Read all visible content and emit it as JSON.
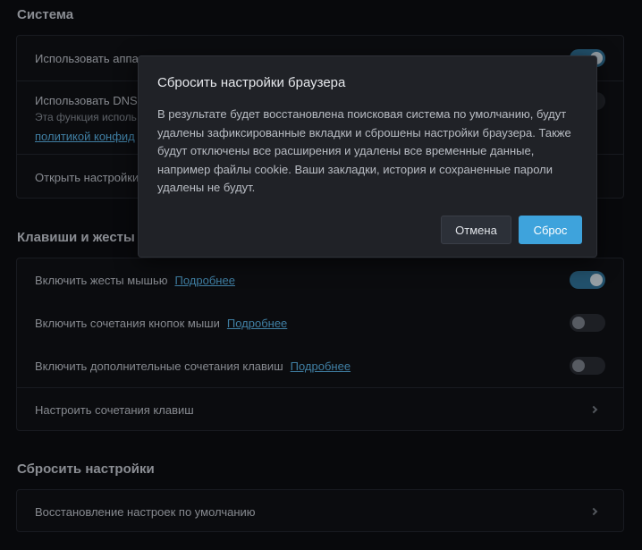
{
  "sections": {
    "system": {
      "title": "Система",
      "rows": {
        "hardware_accel": {
          "label": "Использовать аппа"
        },
        "dns": {
          "label": "Использовать DNS",
          "desc": "Эта функция исполь",
          "link": "политикой конфид"
        },
        "open_settings": {
          "label": "Открыть настройки"
        }
      }
    },
    "keys": {
      "title": "Клавиши и жесты",
      "rows": {
        "mouse_gestures": {
          "label": "Включить жесты мышью",
          "more": "Подробнее",
          "enabled": true
        },
        "mouse_combos": {
          "label": "Включить сочетания кнопок мыши",
          "more": "Подробнее",
          "enabled": false
        },
        "extra_hotkeys": {
          "label": "Включить дополнительные сочетания клавиш",
          "more": "Подробнее",
          "enabled": false
        },
        "configure": {
          "label": "Настроить сочетания клавиш"
        }
      }
    },
    "reset": {
      "title": "Сбросить настройки",
      "rows": {
        "restore": {
          "label": "Восстановление настроек по умолчанию"
        }
      }
    }
  },
  "modal": {
    "title": "Сбросить настройки браузера",
    "body": "В результате будет восстановлена поисковая система по умолчанию, будут удалены зафиксированные вкладки и сброшены настройки браузера. Также будут отключены все расширения и удалены все временные данные, например файлы cookie. Ваши закладки, история и сохраненные пароли удалены не будут.",
    "cancel_label": "Отмена",
    "reset_label": "Сброс"
  },
  "colors": {
    "background": "#0b0c10",
    "accent": "#3ea3dc",
    "link": "#55a8d9",
    "toggle_on": "#2e6d91"
  }
}
